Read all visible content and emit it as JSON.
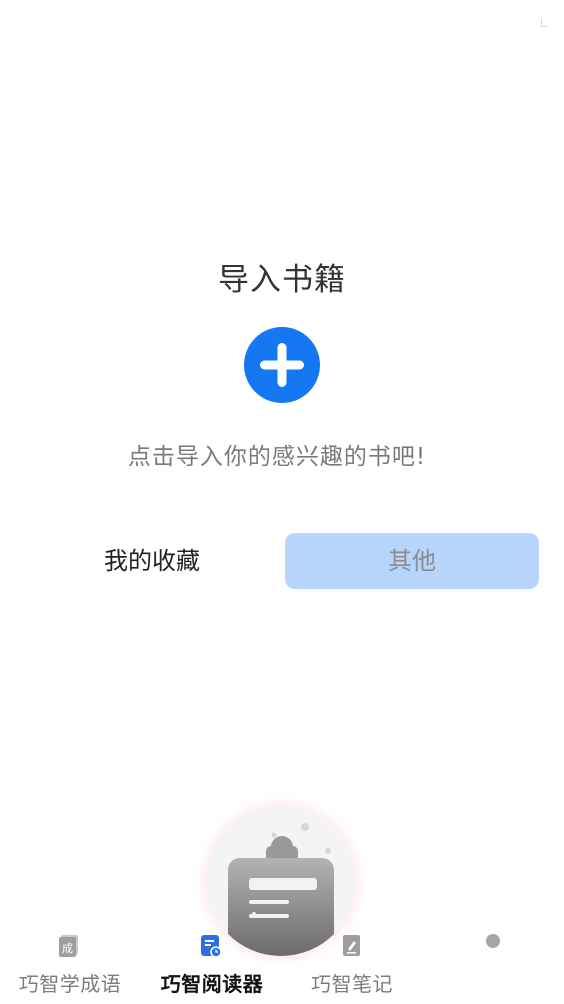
{
  "import": {
    "title": "导入书籍",
    "hint": "点击导入你的感兴趣的书吧!",
    "add_icon": "plus-icon"
  },
  "tabs": {
    "favorites_label": "我的收藏",
    "other_label": "其他",
    "selected": "其他"
  },
  "fab": {
    "icon": "reading-stand-icon"
  },
  "bottom_nav": {
    "items": [
      {
        "label": "巧智学成语",
        "icon": "idiom-card-icon",
        "active": false
      },
      {
        "label": "巧智阅读器",
        "icon": "reader-doc-icon",
        "active": true
      },
      {
        "label": "巧智笔记",
        "icon": "note-pen-icon",
        "active": false
      },
      {
        "label": "",
        "icon": "dot-icon",
        "active": false
      }
    ]
  },
  "colors": {
    "accent": "#1677f2",
    "tab_selected_bg": "#b7d4fb",
    "text_primary": "#333333",
    "text_secondary": "#7a7a7a"
  }
}
